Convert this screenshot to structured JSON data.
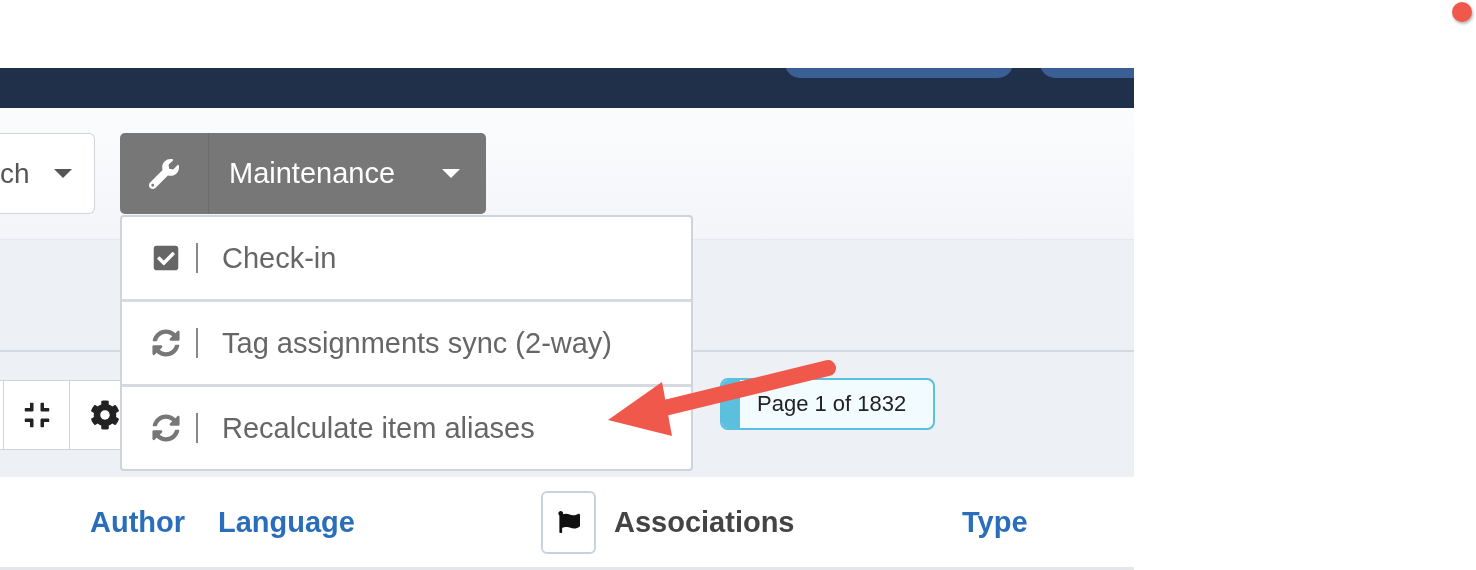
{
  "filter_dropdown": {
    "value": "ch"
  },
  "maintenance_button": {
    "label": "Maintenance",
    "expanded": true
  },
  "maintenance_menu": [
    {
      "kind": "check",
      "label": "Check-in"
    },
    {
      "kind": "sync",
      "label": "Tag assignments sync (2-way)"
    },
    {
      "kind": "sync",
      "label": "Recalculate item aliases"
    }
  ],
  "pagination": {
    "label": "Page 1 of 1832"
  },
  "table": {
    "columns": [
      {
        "kind": "link",
        "label": "Author"
      },
      {
        "kind": "link",
        "label": "Language"
      },
      {
        "kind": "flag"
      },
      {
        "kind": "plain",
        "label": "Associations"
      },
      {
        "kind": "link",
        "label": "Type"
      }
    ]
  }
}
